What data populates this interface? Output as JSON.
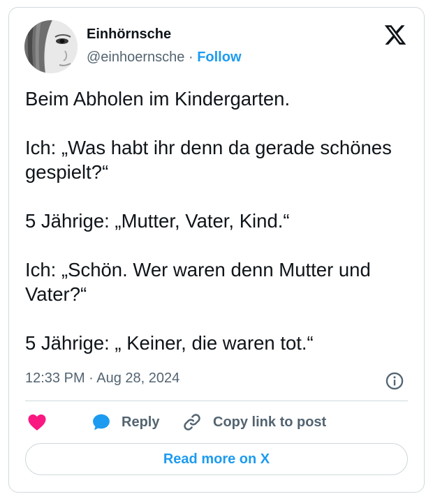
{
  "author": {
    "display_name": "Einhörnsche",
    "handle": "@einhoernsche",
    "separator": "·",
    "follow_label": "Follow"
  },
  "tweet": {
    "paragraphs": [
      "Beim Abholen im Kindergarten.",
      "Ich: „Was habt ihr denn da gerade schönes gespielt?“",
      "5 Jährige: „Mutter, Vater, Kind.“",
      "Ich: „Schön. Wer waren denn Mutter und Vater?“",
      "5 Jährige: „ Keiner, die waren tot.“"
    ],
    "timestamp": "12:33 PM · Aug 28, 2024"
  },
  "actions": {
    "like_icon": "heart-icon",
    "reply_label": "Reply",
    "copy_label": "Copy link to post"
  },
  "read_more_label": "Read more on X",
  "icons": [
    "x-logo-icon",
    "info-icon",
    "heart-icon",
    "reply-bubble-icon",
    "link-icon"
  ],
  "colors": {
    "accent": "#1d9bf0",
    "like": "#f91880",
    "text": "#0f1419",
    "muted": "#536471",
    "border": "#cfd9de"
  }
}
